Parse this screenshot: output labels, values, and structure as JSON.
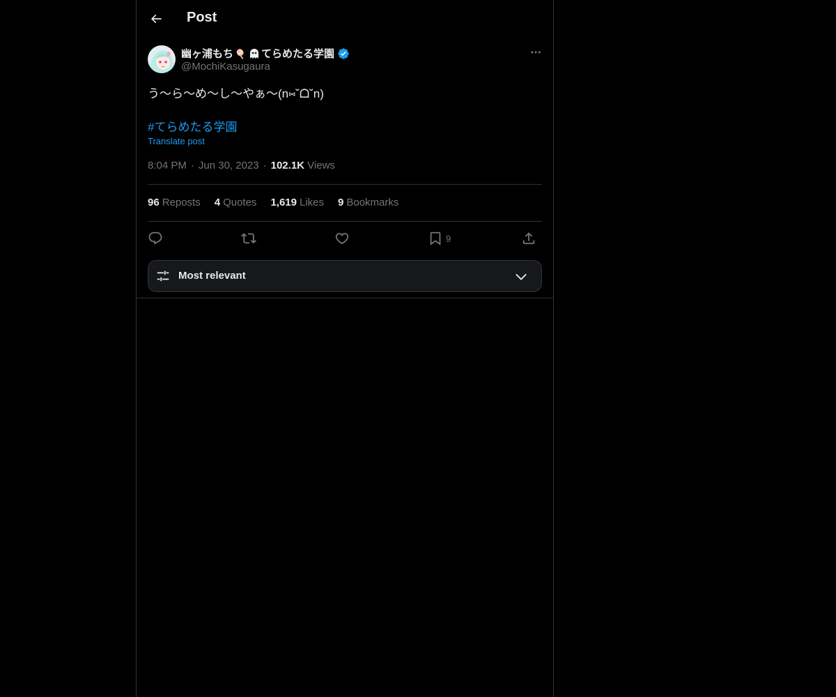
{
  "header": {
    "title": "Post"
  },
  "author": {
    "name_part1": "幽ヶ浦もち",
    "name_part2": "てらめたる学園",
    "handle": "@MochiKasugaura",
    "verified": true
  },
  "post": {
    "text": "う〜ら〜め〜し〜やぁ〜(n⑅˘ᗝ˘n)",
    "hashtag": "#てらめたる学園",
    "translate_label": "Translate post",
    "time": "8:04 PM",
    "date": "Jun 30, 2023",
    "views_count": "102.1K",
    "views_label": "Views"
  },
  "stats": {
    "reposts_count": "96",
    "reposts_label": "Reposts",
    "quotes_count": "4",
    "quotes_label": "Quotes",
    "likes_count": "1,619",
    "likes_label": "Likes",
    "bookmarks_count": "9",
    "bookmarks_label": "Bookmarks"
  },
  "actions": {
    "bookmark_count": "9"
  },
  "sort": {
    "label": "Most relevant"
  },
  "colors": {
    "background": "#000000",
    "text": "#e7e9ea",
    "muted": "#71767b",
    "accent": "#1d9bf0",
    "border": "#2f3336"
  },
  "icons": {
    "back": "arrow-left-icon",
    "more": "more-dots-icon",
    "verified": "verified-badge-icon",
    "reply": "reply-icon",
    "repost": "repost-icon",
    "like": "heart-icon",
    "bookmark": "bookmark-icon",
    "share": "share-icon",
    "sort": "sliders-icon",
    "chevron": "chevron-down-icon"
  }
}
